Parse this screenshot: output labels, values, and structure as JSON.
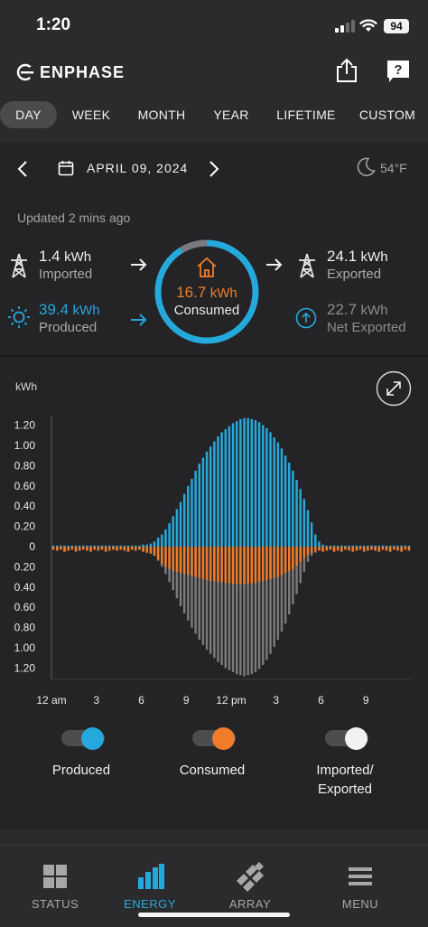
{
  "status_bar": {
    "time": "1:20",
    "battery": "94"
  },
  "header": {
    "brand": "ENPHASE"
  },
  "tabs": [
    {
      "label": "DAY",
      "active": true
    },
    {
      "label": "WEEK"
    },
    {
      "label": "MONTH"
    },
    {
      "label": "YEAR"
    },
    {
      "label": "LIFETIME"
    },
    {
      "label": "CUSTOM"
    }
  ],
  "date_nav": {
    "date": "APRIL 09, 2024",
    "temperature": "54°F"
  },
  "updated": "Updated 2 mins ago",
  "stats": {
    "imported": {
      "value": "1.4",
      "unit": "kWh",
      "label": "Imported"
    },
    "produced": {
      "value": "39.4",
      "unit": "kWh",
      "label": "Produced"
    },
    "consumed": {
      "value": "16.7",
      "unit": "kWh",
      "label": "Consumed"
    },
    "exported": {
      "value": "24.1",
      "unit": "kWh",
      "label": "Exported"
    },
    "net_exported": {
      "value": "22.7",
      "unit": "kWh",
      "label": "Net Exported"
    }
  },
  "colors": {
    "produced": "#25a9dc",
    "consumed": "#f07c2a",
    "grid": "#7a7a7c",
    "background": "#242426"
  },
  "chart_data": {
    "type": "bar",
    "ylabel": "kWh",
    "y_ticks_up": [
      "1.20",
      "1.00",
      "0.80",
      "0.60",
      "0.40",
      "0.20",
      "0"
    ],
    "y_ticks_down": [
      "0.20",
      "0.40",
      "0.60",
      "0.80",
      "1.00",
      "1.20"
    ],
    "x_ticks": [
      "12 am",
      "3",
      "6",
      "9",
      "12 pm",
      "3",
      "6",
      "9"
    ],
    "ylim": [
      -1.3,
      1.3
    ],
    "x_interval_minutes": 15,
    "series": [
      {
        "name": "Produced",
        "values": [
          0.01,
          0.01,
          0.01,
          0.01,
          0.01,
          0.01,
          0.01,
          0.01,
          0.01,
          0.01,
          0.01,
          0.01,
          0.01,
          0.01,
          0.01,
          0.01,
          0.01,
          0.01,
          0.01,
          0.01,
          0.01,
          0.01,
          0.01,
          0.01,
          0.02,
          0.02,
          0.03,
          0.05,
          0.09,
          0.12,
          0.17,
          0.23,
          0.3,
          0.37,
          0.44,
          0.52,
          0.6,
          0.67,
          0.75,
          0.82,
          0.88,
          0.94,
          0.99,
          1.04,
          1.09,
          1.13,
          1.16,
          1.19,
          1.22,
          1.24,
          1.26,
          1.27,
          1.27,
          1.26,
          1.25,
          1.23,
          1.2,
          1.17,
          1.13,
          1.08,
          1.03,
          0.97,
          0.9,
          0.83,
          0.75,
          0.66,
          0.57,
          0.47,
          0.36,
          0.24,
          0.12,
          0.05,
          0.02,
          0.01,
          0.01,
          0.01,
          0.01,
          0.01,
          0.01,
          0.01,
          0.01,
          0.01,
          0.01,
          0.01,
          0.01,
          0.01,
          0.01,
          0.01,
          0.01,
          0.01,
          0.01,
          0.01,
          0.01,
          0.01,
          0.01,
          0.01
        ]
      },
      {
        "name": "Consumed",
        "values": [
          0.03,
          0.04,
          0.03,
          0.05,
          0.04,
          0.03,
          0.05,
          0.04,
          0.03,
          0.04,
          0.05,
          0.03,
          0.04,
          0.03,
          0.05,
          0.04,
          0.03,
          0.04,
          0.03,
          0.04,
          0.05,
          0.03,
          0.04,
          0.03,
          0.05,
          0.06,
          0.07,
          0.09,
          0.13,
          0.17,
          0.2,
          0.22,
          0.24,
          0.25,
          0.26,
          0.27,
          0.28,
          0.29,
          0.3,
          0.31,
          0.32,
          0.33,
          0.34,
          0.34,
          0.35,
          0.35,
          0.36,
          0.36,
          0.37,
          0.37,
          0.37,
          0.37,
          0.37,
          0.36,
          0.36,
          0.35,
          0.34,
          0.33,
          0.32,
          0.31,
          0.3,
          0.28,
          0.26,
          0.24,
          0.22,
          0.19,
          0.15,
          0.11,
          0.08,
          0.06,
          0.05,
          0.04,
          0.05,
          0.04,
          0.03,
          0.05,
          0.04,
          0.05,
          0.03,
          0.04,
          0.05,
          0.04,
          0.03,
          0.05,
          0.04,
          0.03,
          0.04,
          0.05,
          0.03,
          0.04,
          0.05,
          0.03,
          0.04,
          0.05,
          0.03,
          0.04
        ]
      },
      {
        "name": "Imported/Exported",
        "values": [
          0.03,
          0.04,
          0.03,
          0.05,
          0.04,
          0.03,
          0.05,
          0.04,
          0.03,
          0.04,
          0.05,
          0.03,
          0.04,
          0.03,
          0.05,
          0.04,
          0.03,
          0.04,
          0.03,
          0.04,
          0.05,
          0.03,
          0.04,
          0.03,
          0.05,
          0.06,
          0.07,
          0.09,
          0.14,
          0.2,
          0.27,
          0.35,
          0.43,
          0.51,
          0.59,
          0.66,
          0.73,
          0.8,
          0.86,
          0.92,
          0.97,
          1.02,
          1.06,
          1.1,
          1.14,
          1.17,
          1.2,
          1.22,
          1.24,
          1.26,
          1.27,
          1.28,
          1.27,
          1.26,
          1.24,
          1.21,
          1.17,
          1.12,
          1.06,
          0.99,
          0.92,
          0.84,
          0.76,
          0.67,
          0.57,
          0.47,
          0.36,
          0.25,
          0.15,
          0.09,
          0.06,
          0.04,
          0.05,
          0.04,
          0.03,
          0.05,
          0.04,
          0.05,
          0.03,
          0.04,
          0.05,
          0.04,
          0.03,
          0.05,
          0.04,
          0.03,
          0.04,
          0.05,
          0.03,
          0.04,
          0.05,
          0.03,
          0.04,
          0.05,
          0.03,
          0.04
        ]
      }
    ]
  },
  "legend": [
    {
      "label": "Produced",
      "toggle_on": true
    },
    {
      "label": "Consumed",
      "toggle_on": true
    },
    {
      "label": "Imported/\nExported",
      "toggle_on": true
    }
  ],
  "bottom_nav": [
    {
      "label": "STATUS",
      "icon": "grid-icon",
      "active": false
    },
    {
      "label": "ENERGY",
      "icon": "bar-chart-icon",
      "active": true
    },
    {
      "label": "ARRAY",
      "icon": "solar-array-icon",
      "active": false
    },
    {
      "label": "MENU",
      "icon": "hamburger-icon",
      "active": false
    }
  ]
}
